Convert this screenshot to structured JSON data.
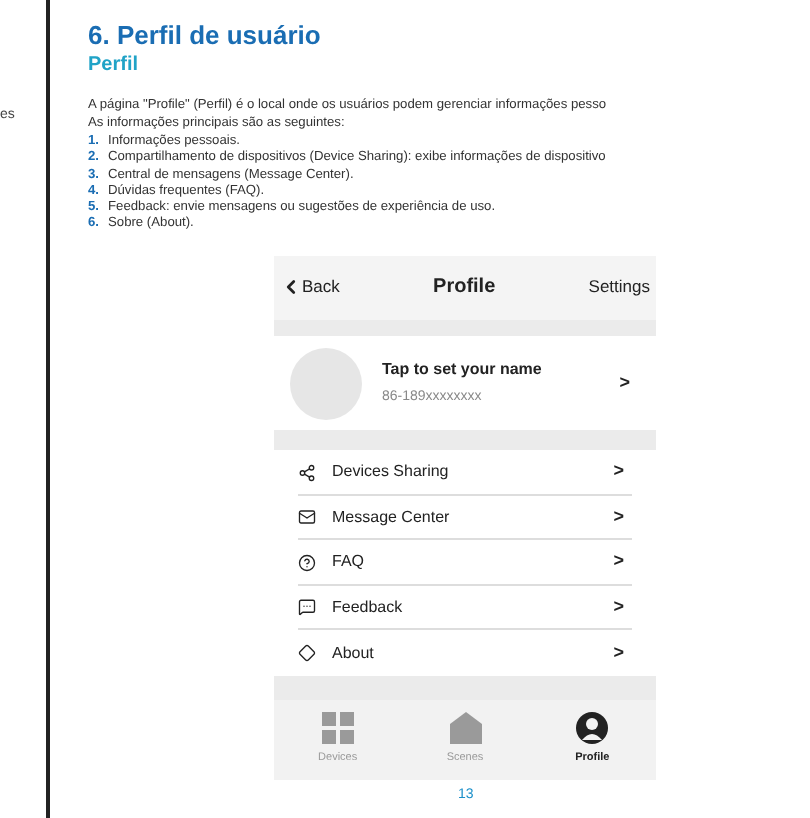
{
  "margin_text": "es",
  "heading": "6. Perfil de usuário",
  "subheading": "Perfil",
  "intro": [
    "A página \"Profile\" (Perfil) é o local onde os usuários podem gerenciar informações pesso",
    "As informações principais são as seguintes:"
  ],
  "list": [
    {
      "number": "1.",
      "text": "Informações pessoais."
    },
    {
      "number": "2.",
      "text": "Compartilhamento de dispositivos (Device Sharing): exibe informações de dispositivo"
    },
    {
      "number": "3.",
      "text": "Central de mensagens (Message Center)."
    },
    {
      "number": "4.",
      "text": "Dúvidas frequentes (FAQ)."
    },
    {
      "number": "5.",
      "text": "Feedback: envie mensagens ou sugestões de experiência de uso."
    },
    {
      "number": "6.",
      "text": "Sobre (About)."
    }
  ],
  "phone": {
    "back": "Back",
    "title": "Profile",
    "settings": "Settings",
    "profile": {
      "name": "Tap to set your name",
      "phone": "86-189xxxxxxxx",
      "chevron": ">"
    },
    "menu": [
      {
        "kind": "share",
        "label": "Devices Sharing",
        "chevron": ">"
      },
      {
        "kind": "mail",
        "label": "Message Center",
        "chevron": ">"
      },
      {
        "kind": "help",
        "label": "FAQ",
        "chevron": ">"
      },
      {
        "kind": "feedback",
        "label": "Feedback",
        "chevron": ">"
      },
      {
        "kind": "about",
        "label": "About",
        "chevron": ">"
      }
    ],
    "tabs": [
      {
        "kind": "grid",
        "label": "Devices",
        "selected": false
      },
      {
        "kind": "home",
        "label": "Scenes",
        "selected": false
      },
      {
        "kind": "user",
        "label": "Profile",
        "selected": true
      }
    ]
  },
  "page_number": "13"
}
